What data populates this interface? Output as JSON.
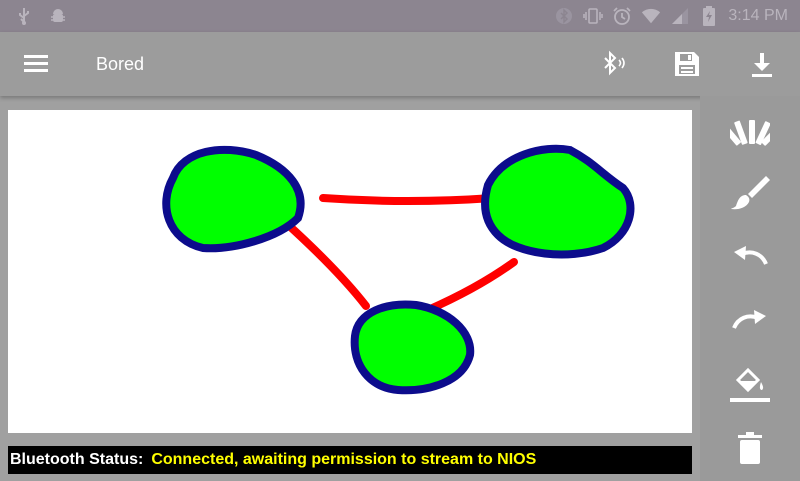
{
  "statusbar": {
    "time": "3:14 PM",
    "left_icons": [
      "usb-icon",
      "android-debug-icon"
    ],
    "right_icons": [
      "bluetooth-off-icon",
      "vibrate-icon",
      "alarm-icon",
      "wifi-icon",
      "signal-icon",
      "battery-icon"
    ]
  },
  "appbar": {
    "title": "Bored",
    "menu_icon": "hamburger-menu-icon",
    "actions": [
      "bluetooth-connect-icon",
      "save-icon",
      "download-icon"
    ]
  },
  "tools": [
    "color-palette-icon",
    "brush-icon",
    "undo-icon",
    "redo-icon",
    "fill-bucket-icon",
    "delete-icon"
  ],
  "status": {
    "label": "Bluetooth Status:",
    "value": "Connected, awaiting permission to stream to NIOS"
  },
  "colors": {
    "node_fill": "#00ff00",
    "node_outline": "#0c0c8c",
    "edge": "#ff0000",
    "status_value": "#ffff00",
    "appbar": "#9c9c9c",
    "statusbar": "#8c8590"
  }
}
